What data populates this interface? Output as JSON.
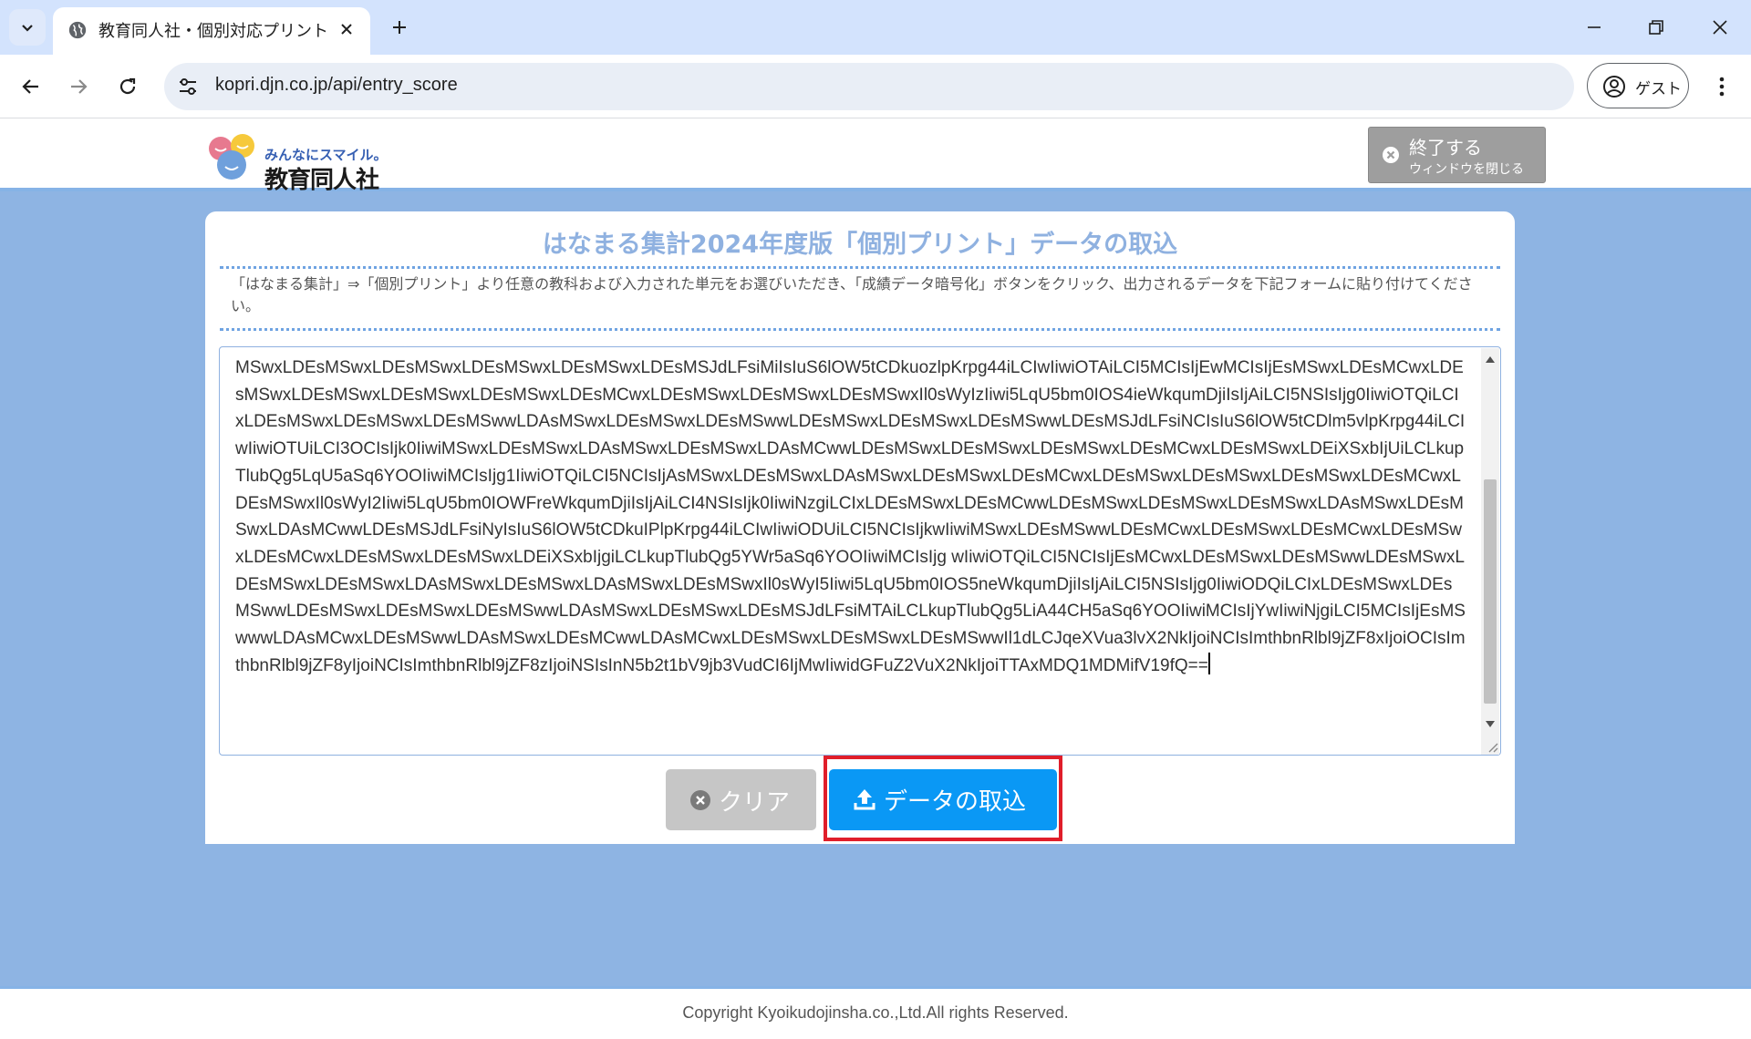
{
  "browser": {
    "tab_title": "教育同人社・個別対応プリント",
    "url": "kopri.djn.co.jp/api/entry_score",
    "profile_label": "ゲスト"
  },
  "header": {
    "logo_tagline": "みんなにスマイル。",
    "logo_name": "教育同人社",
    "exit_button": {
      "main": "終了する",
      "sub": "ウィンドウを閉じる"
    }
  },
  "main": {
    "title": "はなまる集計2024年度版「個別プリント」データの取込",
    "instruction": "「はなまる集計」⇒「個別プリント」より任意の教科および入力された単元をお選びいただき、「成績データ暗号化」ボタンをクリック、出力されるデータを下記フォームに貼り付けてください。",
    "textarea_value": "MSwxLDEsMSwxLDEsMSwxLDEsMSwxLDEsMSwxLDEsMSJdLFsiMiIsIuS6lOW5tCDkuozlpKrpg44iLCIwIiwiOTAiLCI5MCIsIjEwMCIsIjEsMSwxLDEsMCwxLDEsMSwxLDEsMSwxLDEsMSwxLDEsMSwxLDEsMCwxLDEsMSwxLDEsMSwxLDEsMSwxIl0sWyIzIiwi5LqU5bm0IOS4ieWkqumDjiIsIjAiLCI5NSIsIjg0IiwiOTQiLCIxLDEsMSwxLDEsMSwxLDEsMSwwLDAsMSwxLDEsMSwxLDEsMSwwLDEsMSwxLDEsMSwxLDEsMSwwLDEsMSJdLFsiNCIsIuS6lOW5tCDlm5vlpKrpg44iLCIwIiwiOTUiLCI3OCIsIjk0IiwiMSwxLDEsMSwxLDAsMSwxLDEsMSwxLDAsMCwwLDEsMSwxLDEsMSwxLDEsMSwxLDEsMCwxLDEsMSwxLDEiXSxbIjUiLCLkupTlubQg5LqU5aSq6YOOIiwiMCIsIjg1IiwiOTQiLCI5NCIsIjAsMSwxLDEsMSwxLDAsMSwxLDEsMSwxLDEsMCwxLDEsMSwxLDEsMSwxLDEsMSwxLDEsMCwxLDEsMSwxIl0sWyI2Iiwi5LqU5bm0IOWFreWkqumDjiIsIjAiLCI4NSIsIjk0IiwiNzgiLCIxLDEsMSwxLDEsMCwwLDEsMSwxLDEsMSwxLDEsMSwxLDAsMSwxLDEsMSwxLDAsMCwwLDEsMSJdLFsiNyIsIuS6lOW5tCDkuIPlpKrpg44iLCIwIiwiODUiLCI5NCIsIjkwIiwiMSwxLDEsMSwwLDEsMCwxLDEsMSwxLDEsMCwxLDEsMSwxLDEsMCwxLDEsMSwxLDEsMSwxLDEiXSxbIjgiLCLkupTlubQg5YWr5aSq6YOOIiwiMCIsIjg wIiwiOTQiLCI5NCIsIjEsMCwxLDEsMSwxLDEsMSwwLDEsMSwxLDEsMSwxLDEsMSwxLDAsMSwxLDEsMSwxLDAsMSwxLDEsMSwxIl0sWyI5Iiwi5LqU5bm0IOS5neWkqumDjiIsIjAiLCI5NSIsIjg0IiwiODQiLCIxLDEsMSwxLDEsMSwwLDEsMSwxLDEsMSwxLDEsMSwwLDAsMSwxLDEsMSwxLDEsMSJdLFsiMTAiLCLkupTlubQg5LiA44CH5aSq6YOOIiwiMCIsIjYwIiwiNjgiLCI5MCIsIjEsMSwwwLDAsMCwxLDEsMSwwLDAsMSwxLDEsMCwwLDAsMCwxLDEsMSwxLDEsMSwxLDEsMSwwIl1dLCJqeXVua3lvX2NkIjoiNCIsImthbnRlbl9jZF8xIjoiOCIsImthbnRlbl9jZF8yIjoiNCIsImthbnRlbl9jZF8zIjoiNSIsInN5b2t1bV9jb3VudCI6IjMwIiwidGFuZ2VuX2NkIjoiTTAxMDQ1MDMifV19fQ=="
  },
  "actions": {
    "clear_label": "クリア",
    "import_label": "データの取込"
  },
  "footer": {
    "copyright": "Copyright Kyoikudojinsha.co.,Ltd.All rights Reserved."
  },
  "colors": {
    "page_background": "#8eb4e3",
    "title_color": "#8fb1e0",
    "import_button": "#0a98f5",
    "clear_button": "#c6c6c6",
    "highlight": "#e01e2a"
  },
  "icons": {
    "tab_list": "chevron-down-icon",
    "favicon": "globe-icon",
    "tab_close": "close-icon",
    "new_tab": "plus-icon",
    "back": "arrow-left-icon",
    "forward": "arrow-right-icon",
    "reload": "reload-icon",
    "site_info": "tune-icon",
    "profile": "account-circle-icon",
    "menu": "more-vert-icon",
    "exit": "close-circle-icon",
    "clear": "close-circle-icon",
    "import": "upload-icon"
  }
}
